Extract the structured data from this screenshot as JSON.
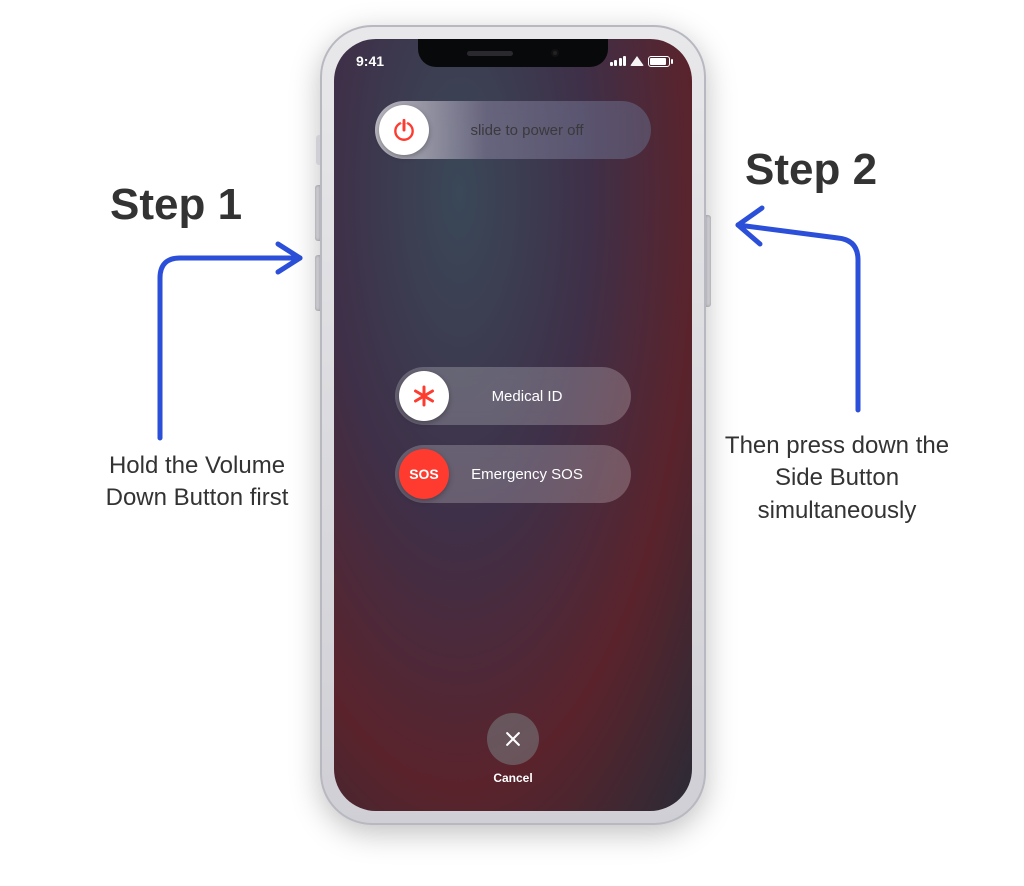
{
  "statusbar": {
    "time": "9:41"
  },
  "sliders": {
    "power_off_label": "slide to power off",
    "medical_id_label": "Medical ID",
    "emergency_sos_label": "Emergency SOS",
    "sos_knob_text": "SOS"
  },
  "cancel": {
    "label": "Cancel"
  },
  "annotations": {
    "step1": {
      "title": "Step 1",
      "desc": "Hold the Volume Down Button first"
    },
    "step2": {
      "title": "Step 2",
      "desc": "Then press down the Side Button simultaneously"
    }
  },
  "colors": {
    "accent_red": "#ff3b30",
    "arrow_blue": "#2b4fd8"
  }
}
